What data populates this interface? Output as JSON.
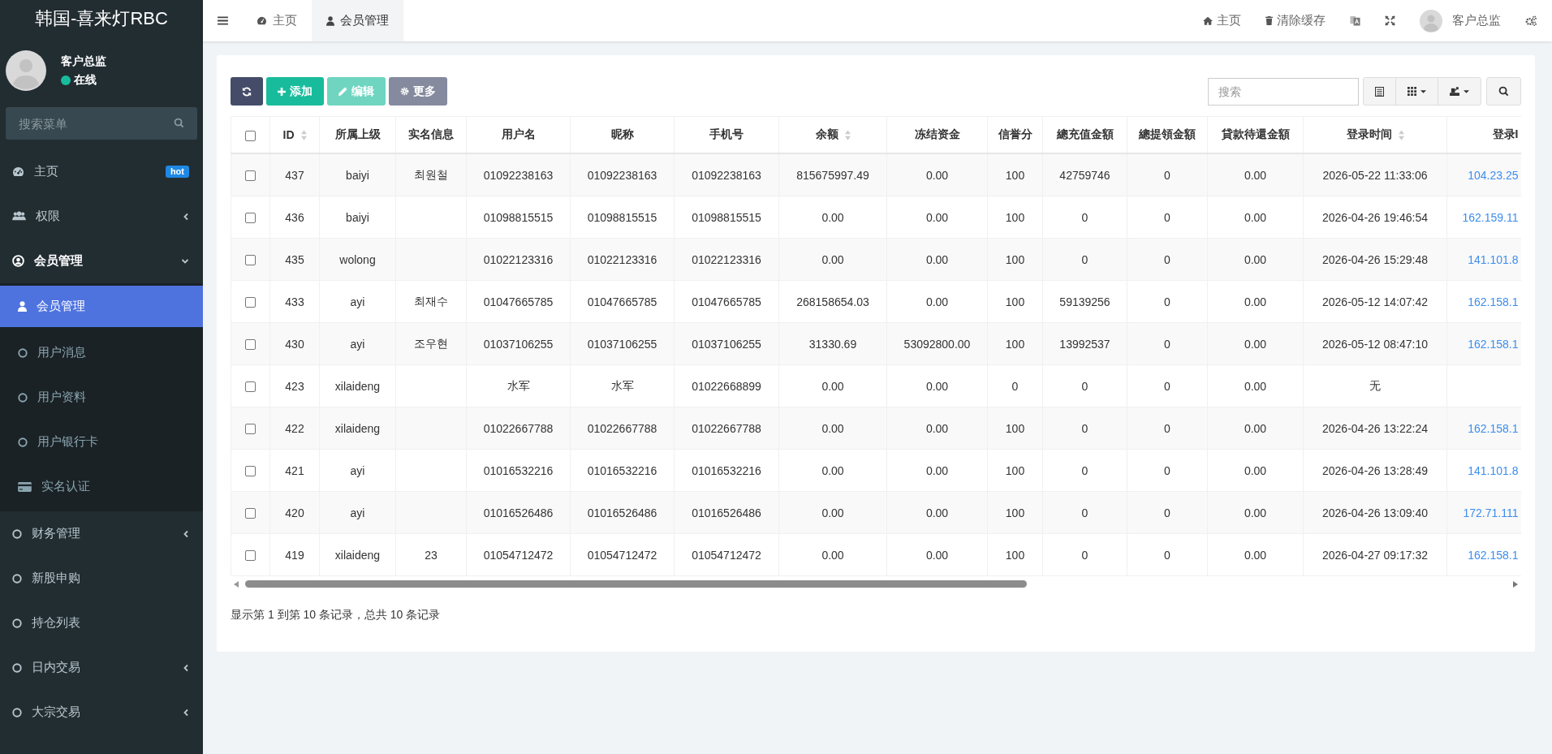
{
  "brand": "韩国-喜来灯RBC",
  "user_panel": {
    "name": "客户总监",
    "status": "在线",
    "online": true
  },
  "sidebar": {
    "search_placeholder": "搜索菜单",
    "menu": [
      {
        "kind": "link",
        "label": "主页",
        "badge": "hot"
      },
      {
        "kind": "group",
        "label": "权限",
        "expanded": false
      },
      {
        "kind": "group",
        "label": "会员管理",
        "expanded": true,
        "children": [
          {
            "label": "会员管理",
            "selected": true
          },
          {
            "label": "用户消息",
            "selected": false
          },
          {
            "label": "用户资料",
            "selected": false
          },
          {
            "label": "用户银行卡",
            "selected": false
          },
          {
            "label": "实名认证",
            "selected": false
          }
        ]
      },
      {
        "kind": "group",
        "label": "财务管理",
        "expanded": false
      },
      {
        "kind": "link",
        "label": "新股申购"
      },
      {
        "kind": "link",
        "label": "持仓列表"
      },
      {
        "kind": "group",
        "label": "日内交易",
        "expanded": false
      },
      {
        "kind": "group",
        "label": "大宗交易",
        "expanded": false
      }
    ]
  },
  "tabs": [
    {
      "label": "主页",
      "selected": false
    },
    {
      "label": "会员管理",
      "selected": true
    }
  ],
  "topbar": {
    "home": "主页",
    "clear_cache": "清除缓存",
    "user": "客户总监"
  },
  "toolbar": {
    "buttons": [
      {
        "kind": "refresh",
        "disabled": false
      },
      {
        "kind": "add",
        "label": "添加",
        "disabled": false
      },
      {
        "kind": "edit",
        "label": "编辑",
        "disabled": true
      },
      {
        "kind": "more",
        "label": "更多",
        "disabled": false
      }
    ],
    "search_placeholder": "搜索"
  },
  "table": {
    "select_all_checked": false,
    "columns": [
      {
        "label": "ID",
        "sortable": true
      },
      {
        "label": "所属上级",
        "sortable": false
      },
      {
        "label": "实名信息",
        "sortable": false
      },
      {
        "label": "用户名",
        "sortable": false
      },
      {
        "label": "昵称",
        "sortable": false
      },
      {
        "label": "手机号",
        "sortable": false
      },
      {
        "label": "余额",
        "sortable": true
      },
      {
        "label": "冻结资金",
        "sortable": false
      },
      {
        "label": "信誉分",
        "sortable": false
      },
      {
        "label": "總充值金額",
        "sortable": false
      },
      {
        "label": "總提領金額",
        "sortable": false
      },
      {
        "label": "貸款待還金額",
        "sortable": false
      },
      {
        "label": "登录时间",
        "sortable": true
      },
      {
        "label": "登录I",
        "sortable": false
      }
    ],
    "rows": [
      {
        "checked": false,
        "cells": [
          "437",
          "baiyi",
          "최원철",
          "01092238163",
          "01092238163",
          "01092238163",
          "815675997.49",
          "0.00",
          "100",
          "42759746",
          "0",
          "0.00",
          "2026-05-22 11:33:06",
          "104.23.25"
        ]
      },
      {
        "checked": false,
        "cells": [
          "436",
          "baiyi",
          null,
          "01098815515",
          "01098815515",
          "01098815515",
          "0.00",
          "0.00",
          "100",
          "0",
          "0",
          "0.00",
          "2026-04-26 19:46:54",
          "162.159.11"
        ]
      },
      {
        "checked": false,
        "cells": [
          "435",
          "wolong",
          null,
          "01022123316",
          "01022123316",
          "01022123316",
          "0.00",
          "0.00",
          "100",
          "0",
          "0",
          "0.00",
          "2026-04-26 15:29:48",
          "141.101.8"
        ]
      },
      {
        "checked": false,
        "cells": [
          "433",
          "ayi",
          "최재수",
          "01047665785",
          "01047665785",
          "01047665785",
          "268158654.03",
          "0.00",
          "100",
          "59139256",
          "0",
          "0.00",
          "2026-05-12 14:07:42",
          "162.158.1"
        ]
      },
      {
        "checked": false,
        "cells": [
          "430",
          "ayi",
          "조우현",
          "01037106255",
          "01037106255",
          "01037106255",
          "31330.69",
          "53092800.00",
          "100",
          "13992537",
          "0",
          "0.00",
          "2026-05-12 08:47:10",
          "162.158.1"
        ]
      },
      {
        "checked": false,
        "cells": [
          "423",
          "xilaideng",
          null,
          "水军",
          "水军",
          "01022668899",
          "0.00",
          "0.00",
          "0",
          "0",
          "0",
          "0.00",
          "无",
          null
        ]
      },
      {
        "checked": false,
        "cells": [
          "422",
          "xilaideng",
          null,
          "01022667788",
          "01022667788",
          "01022667788",
          "0.00",
          "0.00",
          "100",
          "0",
          "0",
          "0.00",
          "2026-04-26 13:22:24",
          "162.158.1"
        ]
      },
      {
        "checked": false,
        "cells": [
          "421",
          "ayi",
          null,
          "01016532216",
          "01016532216",
          "01016532216",
          "0.00",
          "0.00",
          "100",
          "0",
          "0",
          "0.00",
          "2026-04-26 13:28:49",
          "141.101.8"
        ]
      },
      {
        "checked": false,
        "cells": [
          "420",
          "ayi",
          null,
          "01016526486",
          "01016526486",
          "01016526486",
          "0.00",
          "0.00",
          "100",
          "0",
          "0",
          "0.00",
          "2026-04-26 13:09:40",
          "172.71.111"
        ]
      },
      {
        "checked": false,
        "cells": [
          "419",
          "xilaideng",
          "23",
          "01054712472",
          "01054712472",
          "01054712472",
          "0.00",
          "0.00",
          "100",
          "0",
          "0",
          "0.00",
          "2026-04-27 09:17:32",
          "162.158.1"
        ]
      }
    ],
    "footer": "显示第 1 到第 10 条记录，总共 10 条记录"
  }
}
